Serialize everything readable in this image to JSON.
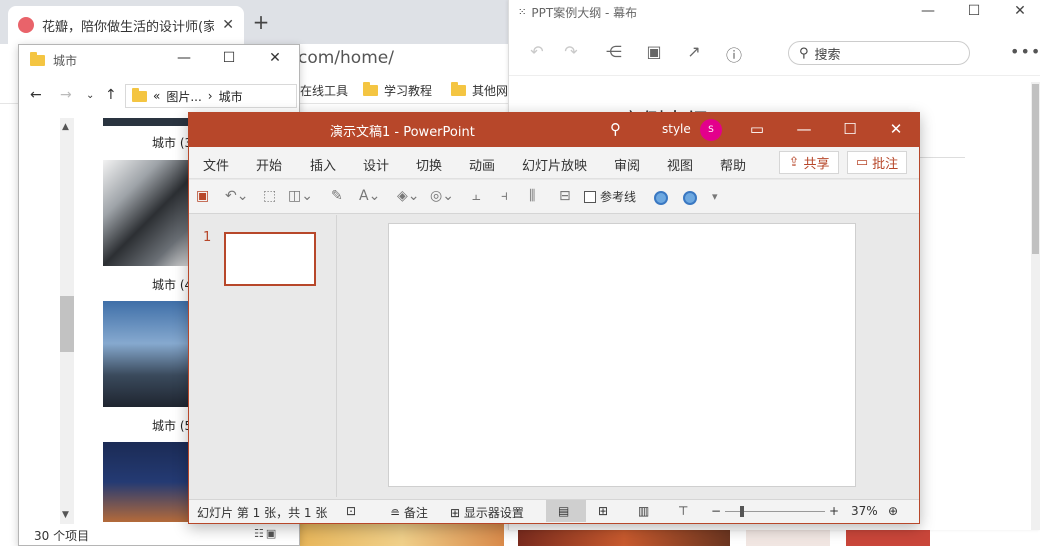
{
  "browser": {
    "tab_title": "花瓣，陪你做生活的设计师(家居",
    "tab_close": "✕",
    "new_tab": "+",
    "address_tail": "com/home/",
    "bookmarks": [
      "在线工具",
      "学习教程",
      "其他网"
    ]
  },
  "mubu": {
    "window_title": "PPT案例大纲 - 幕布",
    "logo_glyph": "⁙",
    "window_controls": [
      "—",
      "☐",
      "✕"
    ],
    "toolbar_icons": [
      "undo-icon",
      "redo-icon",
      "mindmap-icon",
      "present-icon",
      "share-icon",
      "help-icon"
    ],
    "search_placeholder": "搜索",
    "more": "•••",
    "doc_title": "PPT案例大纲"
  },
  "explorer": {
    "title": "城市",
    "window_controls": [
      "—",
      "☐",
      "✕"
    ],
    "path": [
      "«",
      "图片...",
      "›",
      "城市"
    ],
    "items": [
      {
        "label": "城市 (3"
      },
      {
        "label": "城市 (4"
      },
      {
        "label": "城市 (5"
      }
    ],
    "status": "30 个项目"
  },
  "ppt": {
    "title": "演示文稿1  -  PowerPoint",
    "user": "style",
    "avatar_initial": "S",
    "window_controls": [
      "▭",
      "—",
      "☐",
      "✕"
    ],
    "tabs": [
      "文件",
      "开始",
      "插入",
      "设计",
      "切换",
      "动画",
      "幻灯片放映",
      "审阅",
      "视图",
      "帮助"
    ],
    "share": "共享",
    "comment": "批注",
    "guides_label": "参考线",
    "slide_number": "1",
    "status": {
      "slide_info": "幻灯片 第 1 张，共 1 张",
      "notes": "备注",
      "display_settings": "显示器设置",
      "zoom_minus": "−",
      "zoom_plus": "+",
      "zoom": "37%"
    }
  },
  "colors": {
    "ppt_accent": "#b7472a",
    "avatar": "#e3008c",
    "folder": "#f4c542"
  }
}
